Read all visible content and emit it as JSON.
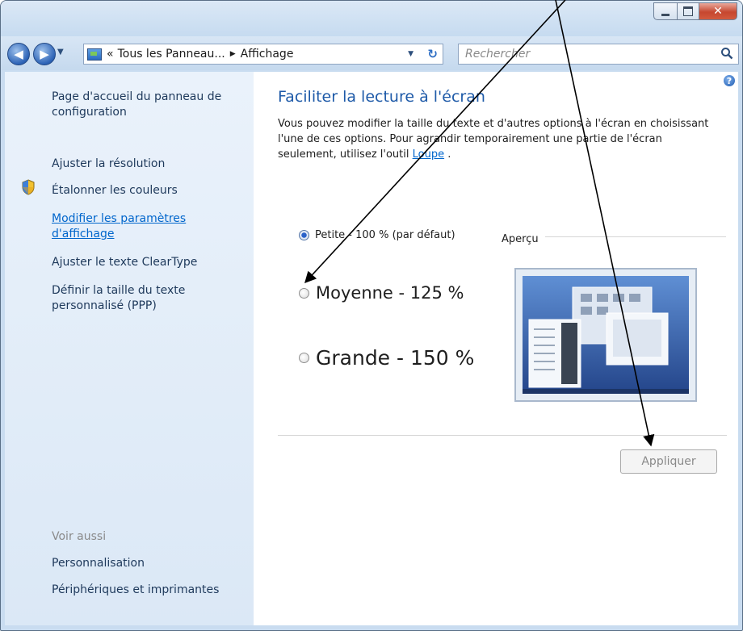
{
  "window": {
    "buttons": {
      "minimize": "minimize-icon",
      "maximize": "maximize-icon",
      "close": "close-icon"
    }
  },
  "navbar": {
    "address_prefix": "«",
    "breadcrumb": [
      "Tous les Panneau...",
      "Affichage"
    ],
    "search_placeholder": "Rechercher"
  },
  "sidebar": {
    "items": [
      {
        "label": "Page d'accueil du panneau de configuration"
      },
      {
        "label": "Ajuster la résolution"
      },
      {
        "label": "Étalonner les couleurs",
        "icon": "shield-icon"
      },
      {
        "label": "Modifier les paramètres d'affichage",
        "active": true
      },
      {
        "label": "Ajuster le texte ClearType"
      },
      {
        "label": "Définir la taille du texte personnalisé (PPP)"
      }
    ],
    "see_also_heading": "Voir aussi",
    "see_also": [
      "Personnalisation",
      "Périphériques et imprimantes"
    ]
  },
  "main": {
    "title": "Faciliter la lecture à l'écran",
    "description_before_link": "Vous pouvez modifier la taille du texte et d'autres options à l'écran en choisissant l'une de ces options. Pour agrandir temporairement une partie de l'écran seulement, utilisez l'outil",
    "link": "Loupe",
    "description_after_link": ".",
    "options": [
      {
        "label": "Petite - 100 % (par défaut)",
        "selected": true
      },
      {
        "label": "Moyenne - 125 %",
        "selected": false
      },
      {
        "label": "Grande - 150 %",
        "selected": false
      }
    ],
    "preview_label": "Aperçu",
    "apply_label": "Appliquer",
    "colors": {
      "title": "#1e5aa8",
      "link": "#0066cc",
      "sidebar_text": "#1e395b",
      "muted": "#8a8a8a"
    }
  }
}
